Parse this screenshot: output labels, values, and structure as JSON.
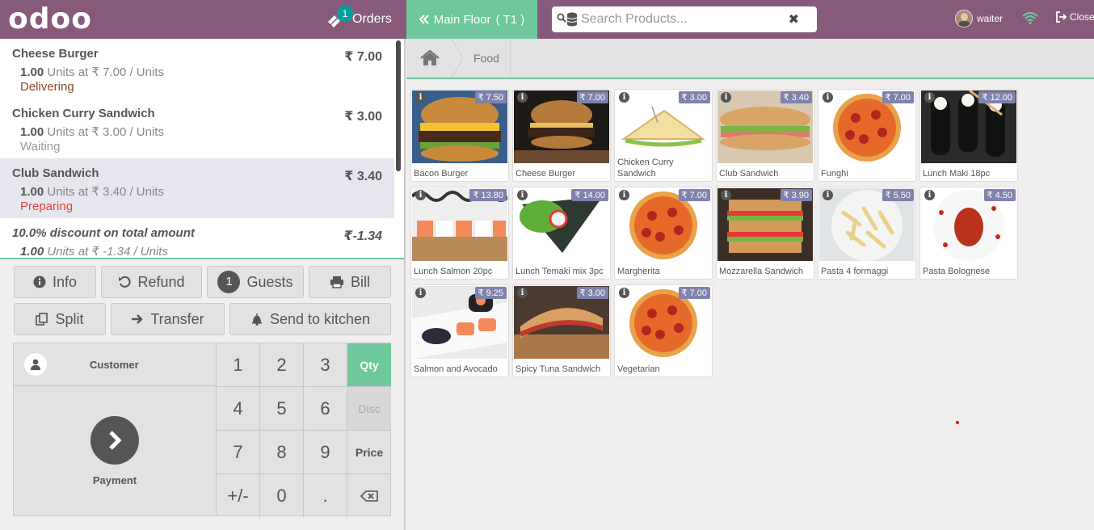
{
  "header": {
    "logo": "odoo",
    "orders_label": "Orders",
    "orders_count": "1",
    "floor_label": "Main Floor",
    "table_label": "( T1 )",
    "search_placeholder": "Search Products...",
    "user_name": "waiter",
    "close_label": "Close"
  },
  "order": {
    "lines": [
      {
        "name": "Cheese Burger",
        "price": "₹ 7.00",
        "qty": "1.00",
        "unit_text": "Units at ₹ 7.00 / Units",
        "status": "Delivering",
        "status_color": "#8b4a2b"
      },
      {
        "name": "Chicken Curry Sandwich",
        "price": "₹ 3.00",
        "qty": "1.00",
        "unit_text": "Units at ₹ 3.00 / Units",
        "status": "Waiting",
        "status_color": "#999999"
      },
      {
        "name": "Club Sandwich",
        "price": "₹ 3.40",
        "qty": "1.00",
        "unit_text": "Units at ₹ 3.40 / Units",
        "status": "Preparing",
        "status_color": "#e8403a"
      },
      {
        "name": "10.0% discount on total amount",
        "price": "₹-1.34",
        "qty": "1.00",
        "unit_text": "Units at ₹ -1.34 / Units",
        "status": ""
      }
    ]
  },
  "actions": {
    "info": "Info",
    "refund": "Refund",
    "guests_count": "1",
    "guests": "Guests",
    "bill": "Bill",
    "split": "Split",
    "transfer": "Transfer",
    "send_to_kitchen": "Send to kitchen"
  },
  "numpad": {
    "customer": "Customer",
    "payment": "Payment",
    "keys": [
      "1",
      "2",
      "3",
      "4",
      "5",
      "6",
      "7",
      "8",
      "9",
      "+/-",
      "0",
      "."
    ],
    "qty": "Qty",
    "disc": "Disc",
    "price": "Price",
    "active_mode": "Qty"
  },
  "breadcrumb": {
    "category": "Food"
  },
  "products": [
    {
      "name": "Bacon Burger",
      "price": "₹ 7.50",
      "icon": "burger"
    },
    {
      "name": "Cheese Burger",
      "price": "₹ 7.00",
      "icon": "burger-dark"
    },
    {
      "name": "Chicken Curry Sandwich",
      "price": "₹ 3.00",
      "icon": "sandwich-triangle"
    },
    {
      "name": "Club Sandwich",
      "price": "₹ 3.40",
      "icon": "sandwich-sub"
    },
    {
      "name": "Funghi",
      "price": "₹ 7.00",
      "icon": "pizza"
    },
    {
      "name": "Lunch Maki 18pc",
      "price": "₹ 12.00",
      "icon": "maki"
    },
    {
      "name": "Lunch Salmon 20pc",
      "price": "₹ 13.80",
      "icon": "sushi"
    },
    {
      "name": "Lunch Temaki mix 3pc",
      "price": "₹ 14.00",
      "icon": "temaki"
    },
    {
      "name": "Margherita",
      "price": "₹ 7.00",
      "icon": "pizza"
    },
    {
      "name": "Mozzarella Sandwich",
      "price": "₹ 3.90",
      "icon": "sandwich-stack"
    },
    {
      "name": "Pasta 4 formaggi",
      "price": "₹ 5.50",
      "icon": "pasta"
    },
    {
      "name": "Pasta Bolognese",
      "price": "₹ 4.50",
      "icon": "pasta-red"
    },
    {
      "name": "Salmon and Avocado",
      "price": "₹ 9.25",
      "icon": "sushi-plate"
    },
    {
      "name": "Spicy Tuna Sandwich",
      "price": "₹ 3.00",
      "icon": "panini"
    },
    {
      "name": "Vegetarian",
      "price": "₹ 7.00",
      "icon": "pizza"
    }
  ],
  "colors": {
    "brand": "#875a7b",
    "accent": "#6ec89b",
    "price_tag": "#7f82ac"
  }
}
